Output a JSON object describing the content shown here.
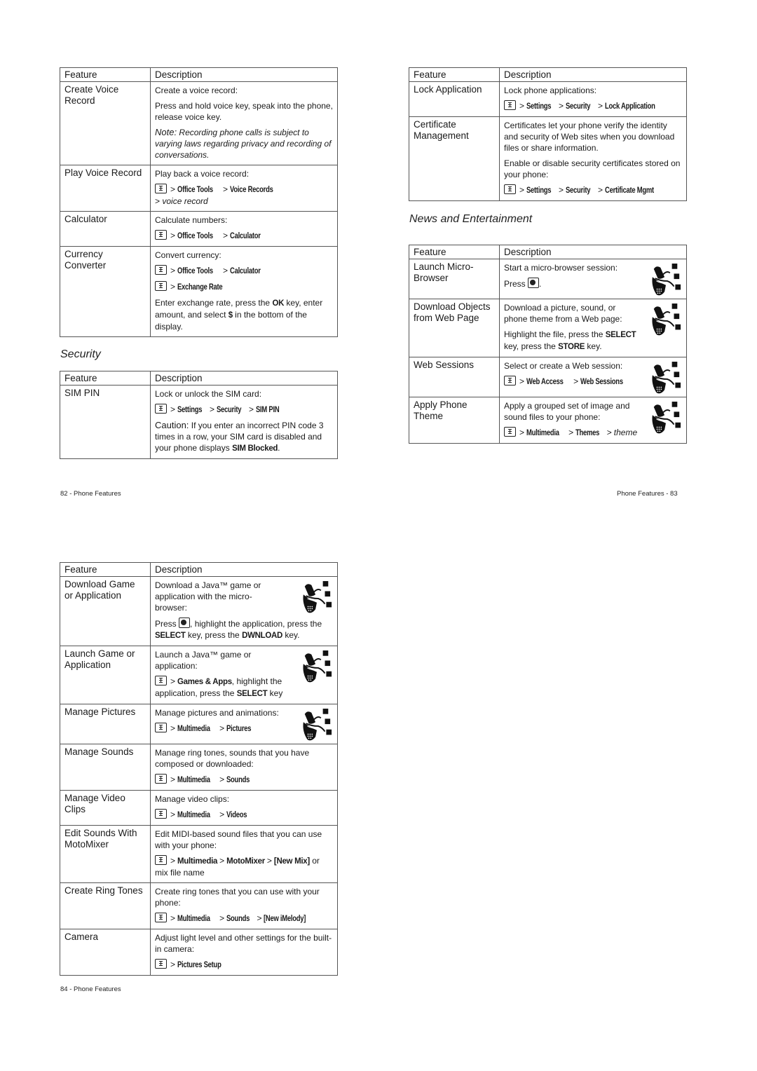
{
  "headers": {
    "feature": "Feature",
    "description": "Description"
  },
  "sep": ">",
  "page82": {
    "table1": {
      "rows": [
        {
          "feature": "Create Voice Record",
          "p1": "Create a voice record:",
          "p2": "Press and hold voice key, speak into the phone, release voice key.",
          "note_label": "Note:",
          "note_text": " Recording phone calls is subject to varying laws regarding privacy and recording of conversations."
        },
        {
          "feature": "Play Voice Record",
          "p1": "Play back a voice record:",
          "path": [
            "Office Tools",
            "Voice Records"
          ],
          "path_tail": "voice record"
        },
        {
          "feature": "Calculator",
          "p1": "Calculate numbers:",
          "path": [
            "Office Tools",
            "Calculator"
          ]
        },
        {
          "feature": "Currency Converter",
          "p1": "Convert currency:",
          "path": [
            "Office Tools",
            "Calculator"
          ],
          "path2": [
            "Exchange Rate"
          ],
          "p3a": "Enter exchange rate, press the ",
          "p3key1": "OK",
          "p3b": " key, enter amount, and select ",
          "p3key2": "$",
          "p3c": " in the bottom of the display."
        }
      ]
    },
    "security_title": "Security",
    "table2": {
      "rows": [
        {
          "feature": "SIM PIN",
          "p1": "Lock or unlock the SIM card:",
          "path": [
            "Settings",
            "Security",
            "SIM PIN"
          ],
          "caution_label": "Caution:",
          "caution_text": " If you enter an incorrect PIN code 3 times in a row, your SIM card is disabled and your phone displays ",
          "caution_key": "SIM Blocked",
          "caution_end": "."
        }
      ]
    },
    "footer": "82 - Phone Features"
  },
  "page83": {
    "table1": {
      "rows": [
        {
          "feature": "Lock Application",
          "p1": "Lock phone applications:",
          "path": [
            "Settings",
            "Security",
            "Lock Application"
          ]
        },
        {
          "feature": "Certificate Management",
          "p1": "Certificates let your phone verify the identity and security of Web sites when you download files or share information.",
          "p2": "Enable or disable security certificates stored on your phone:",
          "path": [
            "Settings",
            "Security",
            "Certificate Mgmt"
          ]
        }
      ]
    },
    "news_title": "News and Entertainment",
    "table2": {
      "rows": [
        {
          "feature": "Launch Micro-Browser",
          "p1": "Start a micro-browser session:",
          "press": "Press",
          "press_end": "."
        },
        {
          "feature": "Download Objects from Web Page",
          "p1": "Download a picture, sound, or phone theme from a Web page:",
          "p2a": "Highlight the file, press the ",
          "key1": "SELECT",
          "p2b": " key, press the ",
          "key2": "STORE",
          "p2c": " key."
        },
        {
          "feature": "Web Sessions",
          "p1": "Select or create a Web session:",
          "path": [
            "Web Access",
            "Web Sessions"
          ]
        },
        {
          "feature": "Apply Phone Theme",
          "p1": "Apply a grouped set of image and sound files to your phone:",
          "path": [
            "Multimedia",
            "Themes"
          ],
          "path_tail": "theme"
        }
      ]
    },
    "footer": "Phone Features - 83"
  },
  "page84": {
    "table": {
      "rows": [
        {
          "feature": "Download Game or Application",
          "p1": "Download a Java™ game or application with the micro-browser:",
          "press": "Press",
          "p2a": ", highlight the application, press the ",
          "key1": "SELECT",
          "p2b": " key, press the ",
          "key2": "DWNLOAD",
          "p2c": " key."
        },
        {
          "feature": "Launch Game or Application",
          "p1": "Launch a Java™ game or application:",
          "path": [
            "Games & Apps"
          ],
          "p2a": ", highlight the application, press the ",
          "key1": "SELECT",
          "p2b": " key"
        },
        {
          "feature": "Manage Pictures",
          "p1": "Manage pictures and animations:",
          "path": [
            "Multimedia",
            "Pictures"
          ]
        },
        {
          "feature": "Manage Sounds",
          "p1": "Manage ring tones, sounds that you have composed or downloaded:",
          "path": [
            "Multimedia",
            "Sounds"
          ]
        },
        {
          "feature": "Manage Video Clips",
          "p1": "Manage video clips:",
          "path": [
            "Multimedia",
            "Videos"
          ]
        },
        {
          "feature": "Edit Sounds With MotoMixer",
          "p1": "Edit MIDI-based sound files that you can use with your phone:",
          "path": [
            "Multimedia",
            "MotoMixer",
            "[New Mix]"
          ],
          "path_tail": " or mix file name"
        },
        {
          "feature": "Create Ring Tones",
          "p1": "Create ring tones that you can use with your phone:",
          "path": [
            "Multimedia",
            "Sounds",
            "[New iMelody]"
          ]
        },
        {
          "feature": "Camera",
          "p1": "Adjust light level and other settings for the built-in camera:",
          "path": [
            "Pictures Setup"
          ]
        }
      ]
    },
    "footer": "84 - Phone Features"
  },
  "icons": {
    "menu": "menu-key-icon",
    "browser": "browser-key-icon",
    "java": "java-phone-icon"
  }
}
